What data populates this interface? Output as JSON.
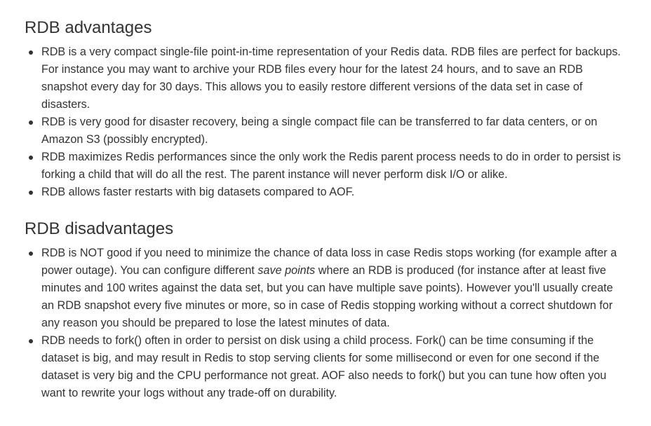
{
  "advantages": {
    "heading": "RDB advantages",
    "items": [
      {
        "lines": [
          "RDB is a very compact single-file point-in-time representation of your Redis data. RDB files are perfect for backups.",
          "For instance you may want to archive your RDB files every hour for the latest 24 hours, and to save an RDB",
          "snapshot every day for 30 days. This allows you to easily restore different versions of the data set in case of",
          "disasters."
        ]
      },
      {
        "lines": [
          "RDB is very good for disaster recovery, being a single compact file can be transferred to far data centers, or on",
          "Amazon S3 (possibly encrypted)."
        ]
      },
      {
        "lines": [
          "RDB maximizes Redis performances since the only work the Redis parent process needs to do in order to persist is",
          "forking a child that will do all the rest. The parent instance will never perform disk I/O or alike."
        ]
      },
      {
        "lines": [
          "RDB allows faster restarts with big datasets compared to AOF."
        ]
      }
    ]
  },
  "disadvantages": {
    "heading": "RDB disadvantages",
    "item1": {
      "line1": "RDB is NOT good if you need to minimize the chance of data loss in case Redis stops working (for example after a",
      "line2_before": "power outage). You can configure different ",
      "line2_em": "save points",
      "line2_after": " where an RDB is produced (for instance after at least five",
      "line3": "minutes and 100 writes against the data set, but you can have multiple save points). However you'll usually create",
      "line4": "an RDB snapshot every five minutes or more, so in case of Redis stopping working without a correct shutdown for",
      "line5": "any reason you should be prepared to lose the latest minutes of data."
    },
    "item2": {
      "lines": [
        "RDB needs to fork() often in order to persist on disk using a child process. Fork() can be time consuming if the",
        "dataset is big, and may result in Redis to stop serving clients for some millisecond or even for one second if the",
        "dataset is very big and the CPU performance not great. AOF also needs to fork() but you can tune how often you",
        "want to rewrite your logs without any trade-off on durability."
      ]
    }
  }
}
